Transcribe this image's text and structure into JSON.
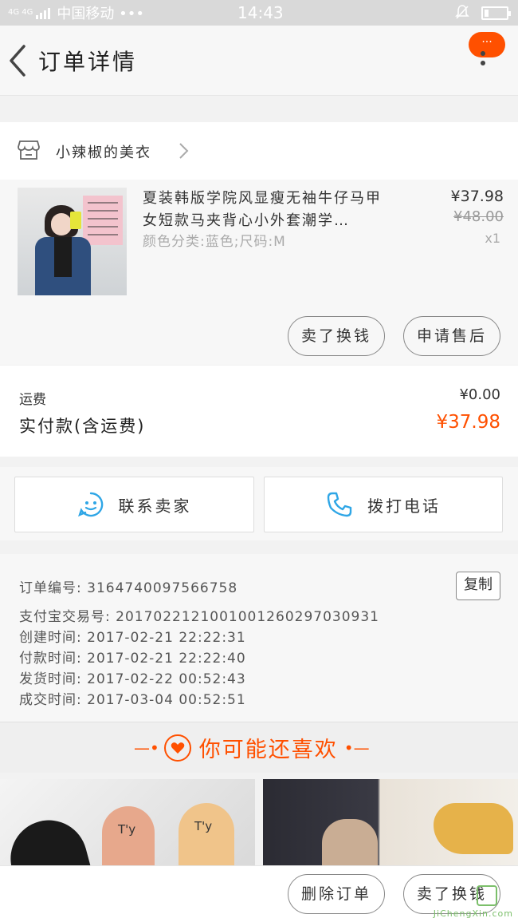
{
  "status_bar": {
    "network": "4G 4G",
    "carrier": "中国移动 •••",
    "time": "14:43"
  },
  "nav": {
    "title": "订单详情",
    "more_badge": "···"
  },
  "shop": {
    "name": "小辣椒的美衣"
  },
  "item": {
    "title": "夏装韩版学院风显瘦无袖牛仔马甲女短款马夹背心小外套潮学…",
    "spec": "颜色分类:蓝色;尺码:M",
    "price": "¥37.98",
    "original_price": "¥48.00",
    "quantity": "x1"
  },
  "item_actions": {
    "sell_label": "卖了换钱",
    "service_label": "申请售后"
  },
  "summary": {
    "shipping_label": "运费",
    "shipping_value": "¥0.00",
    "paid_label": "实付款(含运费)",
    "paid_value": "¥37.98"
  },
  "contact": {
    "seller_label": "联系卖家",
    "phone_label": "拨打电话"
  },
  "order_info": {
    "order_no": "订单编号: 3164740097566758",
    "alipay_no": "支付宝交易号: 2017022121001001260297030931",
    "created": "创建时间: 2017-02-21  22:22:31",
    "paid": "付款时间: 2017-02-21  22:22:40",
    "shipped": "发货时间: 2017-02-22  00:52:43",
    "completed": "成交时间: 2017-03-04  00:52:51",
    "copy_label": "复制"
  },
  "recommend": {
    "title": "你可能还喜欢"
  },
  "bottom_bar": {
    "delete_label": "删除订单",
    "sell_label": "卖了换钱"
  },
  "watermark": "JiChengXin.com",
  "colors": {
    "accent": "#ff5000",
    "blue_icon": "#2fa6e6"
  }
}
